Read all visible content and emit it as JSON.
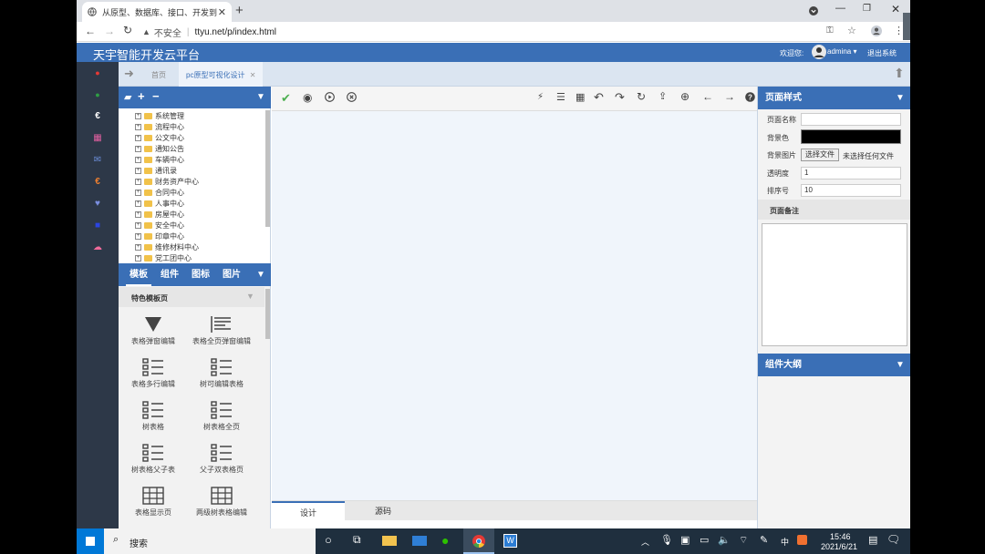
{
  "browser": {
    "tab_title": "从原型、数据库、接口、开发到",
    "security_label": "不安全",
    "url": "ttyu.net/p/index.html"
  },
  "app": {
    "title": "天宇智能开发云平台",
    "welcome": "欢迎您:",
    "user": "admina",
    "logout": "退出系统"
  },
  "page_tabs": [
    {
      "label": "首页"
    },
    {
      "label": "pc原型可视化设计"
    }
  ],
  "tree": {
    "items": [
      "系统管理",
      "流程中心",
      "公文中心",
      "通知公告",
      "车辆中心",
      "通讯录",
      "财务资产中心",
      "合同中心",
      "人事中心",
      "房屋中心",
      "安全中心",
      "印章中心",
      "维修材料中心",
      "党工团中心"
    ]
  },
  "components": {
    "tabs": [
      "模板",
      "组件",
      "图标",
      "图片"
    ],
    "section_title": "特色模板页",
    "cards": [
      "表格弹窗编辑",
      "表格全页弹窗编辑",
      "表格多行编辑",
      "树可编辑表格",
      "树表格",
      "树表格全页",
      "树表格父子表",
      "父子双表格页",
      "表格显示页",
      "两级树表格编辑"
    ]
  },
  "designer": {
    "bottom_tabs": [
      "设计",
      "源码"
    ]
  },
  "properties": {
    "title": "页面样式",
    "fields": {
      "page_name_label": "页面名称",
      "page_name_value": "",
      "bg_color_label": "背景色",
      "bg_color_value": "#000000",
      "bg_image_label": "背景图片",
      "choose_file": "选择文件",
      "no_file": "未选择任何文件",
      "opacity_label": "透明度",
      "opacity_value": "1",
      "order_label": "排序号",
      "order_value": "10"
    },
    "remark_label": "页面备注",
    "outline_title": "组件大纲"
  },
  "taskbar": {
    "search": "搜索",
    "time": "15:46",
    "date": "2021/6/21",
    "ime": "中"
  },
  "colors": {
    "brand": "#3a6fb6",
    "navbar": "#2d3848",
    "canvas": "#f0f5fb"
  }
}
